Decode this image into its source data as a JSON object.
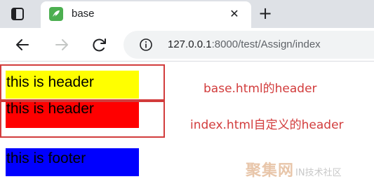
{
  "browser": {
    "tab": {
      "title": "base",
      "close_glyph": "✕"
    },
    "new_tab_glyph": "+",
    "address": {
      "host": "127.0.0.1",
      "rest": ":8000/test/Assign/index"
    },
    "icons": [
      "window-icon",
      "favicon-icon",
      "close-icon",
      "plus-icon",
      "back-arrow-icon",
      "forward-arrow-icon",
      "reload-icon",
      "info-icon"
    ]
  },
  "page": {
    "header_base": "this is header",
    "header_index": "this is header",
    "footer": "this is footer",
    "colors": {
      "header_base": "#ffff00",
      "header_index": "#ff0000",
      "footer": "#0000ff"
    }
  },
  "annotations": {
    "base_note": "base.html的header",
    "index_note": "index.html自定义的header",
    "color": "#d23c3c"
  },
  "watermark": {
    "logo": "聚集网",
    "text": "IN技术社区"
  }
}
